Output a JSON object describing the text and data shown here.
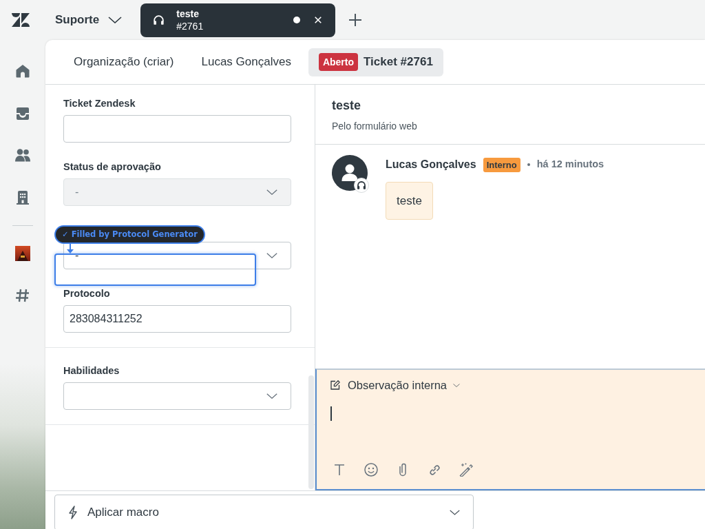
{
  "top_bar": {
    "workspace": "Suporte",
    "tabs": [
      {
        "title": "teste",
        "subtitle": "#2761",
        "selected": true,
        "modified": true
      }
    ]
  },
  "ticket_tabs": [
    {
      "label": "Organização (criar)",
      "selected": false
    },
    {
      "label": "Lucas Gonçalves",
      "selected": false
    },
    {
      "badge": "Aberto",
      "label": "Ticket #2761",
      "selected": true
    }
  ],
  "form": {
    "sections": [
      {
        "fields": [
          {
            "kind": "text",
            "label": "Ticket Zendesk",
            "disabled": false
          },
          {
            "kind": "select",
            "label": "Status de aprovação",
            "value": "-",
            "disabled": true
          },
          {
            "kind": "select",
            "value": "-",
            "disabled": false
          },
          {
            "kind": "text",
            "label": "Protocolo",
            "value": "283084311252",
            "disabled": false
          }
        ]
      },
      {
        "fields": [
          {
            "kind": "select",
            "label": "Habilidades",
            "disabled": false
          }
        ]
      }
    ]
  },
  "autofill_hint": {
    "text": "✓ Filled by Protocol Generator"
  },
  "conversation": {
    "subject": "teste",
    "channel": "Pelo formulário web",
    "messages": [
      {
        "author": "Lucas Gonçalves",
        "tag": "Interno",
        "time": "há 12 minutos",
        "body": "teste"
      }
    ]
  },
  "composer": {
    "mode": "Observação interna"
  },
  "footer": {
    "macro": "Aplicar macro"
  }
}
